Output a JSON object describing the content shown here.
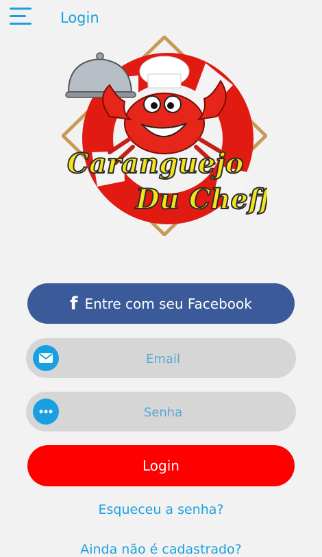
{
  "header": {
    "title": "Login",
    "menu_icon": "hamburger-menu-icon"
  },
  "logo": {
    "line1": "Caranguejo",
    "line2": "Du Cheff",
    "icon": "crab-chef-lifebuoy-logo"
  },
  "facebook_button": {
    "label": "Entre com seu Facebook",
    "icon": "facebook-icon"
  },
  "email_field": {
    "placeholder": "Email",
    "value": "",
    "icon": "mail-icon"
  },
  "password_field": {
    "placeholder": "Senha",
    "value": "",
    "icon": "more-dots-icon"
  },
  "login_button": {
    "label": "Login"
  },
  "forgot_link": "Esqueceu a senha?",
  "signup_link": "Ainda não é cadastrado?",
  "colors": {
    "accent": "#1a9fe0",
    "facebook": "#3b5a9a",
    "login": "#ff0000",
    "background": "#f2f2f2"
  }
}
